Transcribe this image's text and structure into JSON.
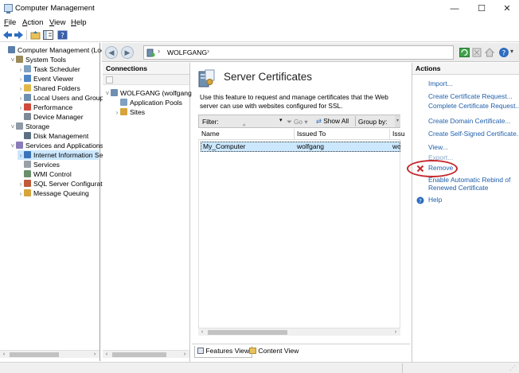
{
  "window": {
    "title": "Computer Management",
    "controls": {
      "minimize": "—",
      "maximize": "☐",
      "close": "✕"
    }
  },
  "menu": {
    "file": "File",
    "action": "Action",
    "view": "View",
    "help": "Help"
  },
  "toolbar": {
    "icons": [
      "back-arrow-icon",
      "forward-arrow-icon",
      "up-folder-icon",
      "show-hide-tree-icon",
      "help-icon"
    ]
  },
  "left_tree": {
    "items": [
      {
        "label": "Computer Management (Local",
        "expander": "",
        "icon": "computer-icon",
        "indent": 0
      },
      {
        "label": "System Tools",
        "expander": "˅",
        "icon": "tools-icon",
        "indent": 1
      },
      {
        "label": "Task Scheduler",
        "expander": "›",
        "icon": "clock-icon",
        "indent": 2
      },
      {
        "label": "Event Viewer",
        "expander": "›",
        "icon": "event-viewer-icon",
        "indent": 2
      },
      {
        "label": "Shared Folders",
        "expander": "›",
        "icon": "shared-folder-icon",
        "indent": 2
      },
      {
        "label": "Local Users and Groups",
        "expander": "›",
        "icon": "users-icon",
        "indent": 2
      },
      {
        "label": "Performance",
        "expander": "›",
        "icon": "performance-icon",
        "indent": 2
      },
      {
        "label": "Device Manager",
        "expander": "",
        "icon": "device-manager-icon",
        "indent": 2
      },
      {
        "label": "Storage",
        "expander": "˅",
        "icon": "storage-icon",
        "indent": 1
      },
      {
        "label": "Disk Management",
        "expander": "",
        "icon": "disk-icon",
        "indent": 2
      },
      {
        "label": "Services and Applications",
        "expander": "˅",
        "icon": "services-apps-icon",
        "indent": 1
      },
      {
        "label": "Internet Information Ser",
        "expander": "›",
        "icon": "iis-icon",
        "indent": 2,
        "selected": true
      },
      {
        "label": "Services",
        "expander": "",
        "icon": "services-icon",
        "indent": 2
      },
      {
        "label": "WMI Control",
        "expander": "",
        "icon": "wmi-icon",
        "indent": 2
      },
      {
        "label": "SQL Server Configuratio",
        "expander": "›",
        "icon": "sql-icon",
        "indent": 2
      },
      {
        "label": "Message Queuing",
        "expander": "›",
        "icon": "message-queue-icon",
        "indent": 2
      }
    ]
  },
  "address_bar": {
    "path_icon": "server-icon",
    "path": "WOLFGANG",
    "separator": "›"
  },
  "connections": {
    "title": "Connections",
    "tree": [
      {
        "label": "WOLFGANG (wolfgang",
        "expander": "˅",
        "icon": "server-icon",
        "indent": 0
      },
      {
        "label": "Application Pools",
        "expander": "",
        "icon": "app-pool-icon",
        "indent": 1
      },
      {
        "label": "Sites",
        "expander": "›",
        "icon": "sites-icon",
        "indent": 1
      }
    ]
  },
  "center": {
    "title": "Server Certificates",
    "description": "Use this feature to request and manage certificates that the Web server can use with websites configured for SSL.",
    "filter": {
      "label": "Filter:",
      "go": "Go",
      "show_all": "Show All",
      "group_by": "Group by:"
    },
    "columns": [
      "Name",
      "Issued To",
      "Issu"
    ],
    "rows": [
      {
        "name": "My_Computer",
        "issued_to": "wolfgang",
        "issued_by": "wo"
      }
    ],
    "tabs": {
      "features": "Features View",
      "content": "Content View"
    }
  },
  "actions": {
    "title": "Actions",
    "items": [
      {
        "label": "Import...",
        "enabled": true,
        "icon": ""
      },
      {
        "label": "Create Certificate Request...",
        "enabled": true,
        "icon": ""
      },
      {
        "label": "Complete Certificate Request...",
        "enabled": true,
        "icon": ""
      },
      {
        "label": "Create Domain Certificate...",
        "enabled": true,
        "icon": ""
      },
      {
        "label": "Create Self-Signed Certificate...",
        "enabled": true,
        "icon": ""
      },
      {
        "label": "View...",
        "enabled": true,
        "icon": ""
      },
      {
        "label": "Export...",
        "enabled": false,
        "icon": ""
      },
      {
        "label": "Remove",
        "enabled": true,
        "icon": "remove-x-icon"
      },
      {
        "label": "Enable Automatic Rebind of Renewed Certificate",
        "enabled": true,
        "icon": ""
      },
      {
        "label": "Help",
        "enabled": true,
        "icon": "help-icon"
      }
    ],
    "highlight_color": "#c6282b"
  },
  "colors": {
    "link": "#1f5fa9",
    "selection": "#cce8ff",
    "annotation": "#c6282b"
  }
}
